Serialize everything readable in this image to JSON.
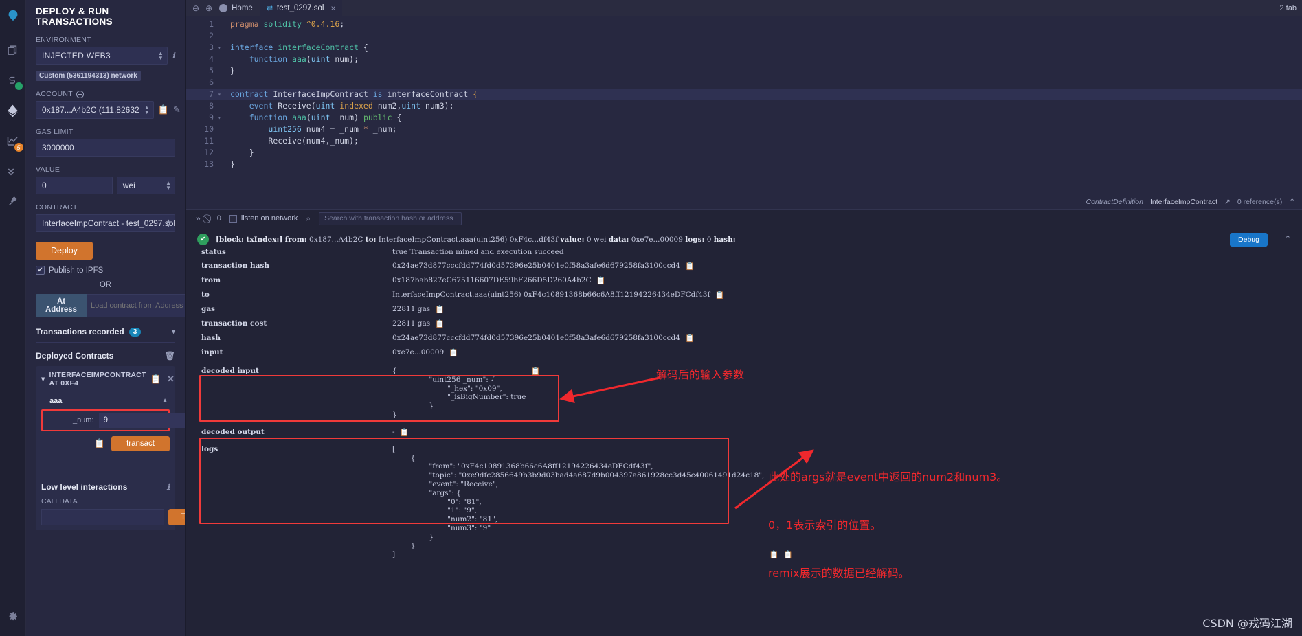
{
  "iconbar": {
    "items": [
      {
        "name": "remix-logo-icon",
        "glyph": "⬤"
      },
      {
        "name": "file-explorer-icon",
        "glyph": "❐"
      },
      {
        "name": "solidity-compiler-icon",
        "glyph": "S",
        "badge": "check"
      },
      {
        "name": "deploy-run-icon",
        "glyph": "◆",
        "active": true
      },
      {
        "name": "analysis-icon",
        "glyph": "↗",
        "badge_num": "5"
      },
      {
        "name": "testing-icon",
        "glyph": "»"
      },
      {
        "name": "plugin-manager-icon",
        "glyph": "⌁"
      }
    ],
    "settings_glyph": "⚙"
  },
  "sidebar": {
    "title": "DEPLOY & RUN TRANSACTIONS",
    "environment_label": "ENVIRONMENT",
    "environment_value": "Injected Web3",
    "network_tag": "Custom (5361194313) network",
    "account_label": "ACCOUNT",
    "account_value": "0x187...A4b2C (111.82632",
    "gas_limit_label": "GAS LIMIT",
    "gas_limit_value": "3000000",
    "value_label": "VALUE",
    "value_amount": "0",
    "value_unit": "wei",
    "contract_label": "CONTRACT",
    "contract_value": "InterfaceImpContract - test_0297.sol",
    "deploy_label": "Deploy",
    "publish_ipfs_label": "Publish to IPFS",
    "publish_ipfs_checked": "✔",
    "or_label": "OR",
    "at_address_label": "At Address",
    "at_address_placeholder": "Load contract from Address",
    "transactions_recorded_label": "Transactions recorded",
    "transactions_recorded_count": "3",
    "deployed_contracts_label": "Deployed Contracts",
    "deployed_contract_name": "INTERFACEIMPCONTRACT AT 0XF4",
    "function_name": "aaa",
    "param_label": "_num:",
    "param_value": "9",
    "transact_label": "transact",
    "low_level_label": "Low level interactions",
    "calldata_label": "CALLDATA",
    "calldata_value": "",
    "transact2_label": "Transact"
  },
  "tabs": {
    "home_label": "Home",
    "file_label": "test_0297.sol",
    "close_glyph": "×",
    "zoom_out_icon": "⊖",
    "zoom_in_icon": "⊕",
    "right_note": "2 tab"
  },
  "editor": {
    "lines": [
      {
        "n": "1",
        "fold": "",
        "html": "<span class=\"k-kw\">pragma</span> <span class=\"k-grn\">solidity</span> <span class=\"k-ver\">^0.4.16</span><span class=\"k-wht\">;</span>"
      },
      {
        "n": "2",
        "fold": "",
        "html": ""
      },
      {
        "n": "3",
        "fold": "▾",
        "html": "<span class=\"k-blue\">interface</span> <span class=\"k-grn\">interfaceContract</span> <span class=\"k-wht\">{</span>"
      },
      {
        "n": "4",
        "fold": "",
        "html": "    <span class=\"k-blue\">function</span> <span class=\"k-fn\">aaa</span><span class=\"k-wht\">(</span><span class=\"k-type\">uint</span> num<span class=\"k-wht\">);</span>"
      },
      {
        "n": "5",
        "fold": "",
        "html": "<span class=\"k-wht\">}</span>"
      },
      {
        "n": "6",
        "fold": "",
        "html": ""
      },
      {
        "n": "7",
        "fold": "▾",
        "html": "<span class=\"k-blue\">contract</span> <span class=\"k-wht\">InterfaceImpContract</span> <span class=\"k-blue\">is</span> <span class=\"k-wht\">interfaceContract</span> <span class=\"k-ind\">{</span>",
        "hl": true
      },
      {
        "n": "8",
        "fold": "",
        "html": "    <span class=\"k-blue\">event</span> <span class=\"k-wht\">Receive(</span><span class=\"k-type\">uint</span> <span class=\"k-ind\">indexed</span> <span class=\"k-wht\">num2,</span><span class=\"k-type\">uint</span> <span class=\"k-wht\">num3);</span>"
      },
      {
        "n": "9",
        "fold": "▾",
        "html": "    <span class=\"k-blue\">function</span> <span class=\"k-fn\">aaa</span><span class=\"k-wht\">(</span><span class=\"k-type\">uint</span> <span class=\"k-wht\">_num)</span> <span class=\"k-pub\">public</span> <span class=\"k-wht\">{</span>"
      },
      {
        "n": "10",
        "fold": "",
        "html": "        <span class=\"k-type\">uint256</span> <span class=\"k-wht\">num4 = _num</span> <span class=\"k-kw\">*</span> <span class=\"k-wht\">_num;</span>"
      },
      {
        "n": "11",
        "fold": "",
        "html": "        <span class=\"k-wht\">Receive(num4,_num);</span>"
      },
      {
        "n": "12",
        "fold": "",
        "html": "    <span class=\"k-wht\">}</span>"
      },
      {
        "n": "13",
        "fold": "",
        "html": "<span class=\"k-wht\">}</span>"
      }
    ],
    "status_type": "ContractDefinition",
    "status_name": "InterfaceImpContract",
    "status_link_icon": "↗",
    "status_refs": "0 reference(s)",
    "status_caret": "⌃"
  },
  "terminal": {
    "collapse_icon": "»",
    "clear_icon": "⃠",
    "count": "0",
    "listen_label": "listen on network",
    "search_icon": "⌕",
    "search_placeholder": "Search with transaction hash or address",
    "tx_header": "[block: txIndex:]  from: 0x187...A4b2C  to: InterfaceImpContract.aaa(uint256) 0xF4c...df43f  value: 0 wei  data: 0xe7e...00009  logs: 0  hash:",
    "debug_label": "Debug",
    "ok_glyph": "✔",
    "caret_glyph": "⌃",
    "rows": [
      {
        "key": "status",
        "value": "true Transaction mined and execution succeed",
        "copy": false
      },
      {
        "key": "transaction hash",
        "value": "0x24ae73d877cccfdd774fd0d57396e25b0401e0f58a3afe6d679258fa3100ccd4",
        "copy": true
      },
      {
        "key": "from",
        "value": "0x187bab827eC675116607DE59bF266D5D260A4b2C",
        "copy": true
      },
      {
        "key": "to",
        "value": "InterfaceImpContract.aaa(uint256) 0xF4c10891368b66c6A8ff12194226434eDFCdf43f",
        "copy": true
      },
      {
        "key": "gas",
        "value": "22811 gas",
        "copy": true
      },
      {
        "key": "transaction cost",
        "value": "22811 gas",
        "copy": true
      },
      {
        "key": "hash",
        "value": "0x24ae73d877cccfdd774fd0d57396e25b0401e0f58a3afe6d679258fa3100ccd4",
        "copy": true
      },
      {
        "key": "input",
        "value": "0xe7e...00009",
        "copy": true
      }
    ],
    "decoded_input_key": "decoded input",
    "decoded_input_json": "{\n\t\t\"uint256 _num\": {\n\t\t\t\"_hex\": \"0x09\",\n\t\t\t\"_isBigNumber\": true\n\t\t}\n}",
    "decoded_output_key": "decoded output",
    "decoded_output_value": "-",
    "logs_key": "logs",
    "logs_json": "[\n\t{\n\t\t\"from\": \"0xF4c10891368b66c6A8ff12194226434eDFCdf43f\",\n\t\t\"topic\": \"0xe9dfc2856649b3b9d03bad4a687d9b004397a861928cc3d45c40061491d24c18\",\n\t\t\"event\": \"Receive\",\n\t\t\"args\": {\n\t\t\t\"0\": \"81\",\n\t\t\t\"1\": \"9\",\n\t\t\t\"num2\": \"81\",\n\t\t\t\"num3\": \"9\"\n\t\t}\n\t}\n]"
  },
  "annotations": {
    "note_decoded_input": "解码后的输入参数",
    "note_logs_line1": "此处的args就是event中返回的num2和num3。",
    "note_logs_line2": "0，1表示索引的位置。",
    "note_logs_line3": "remix展示的数据已经解码。",
    "highlight_color": "#f0282d"
  },
  "watermark": "CSDN @戎码江湖"
}
